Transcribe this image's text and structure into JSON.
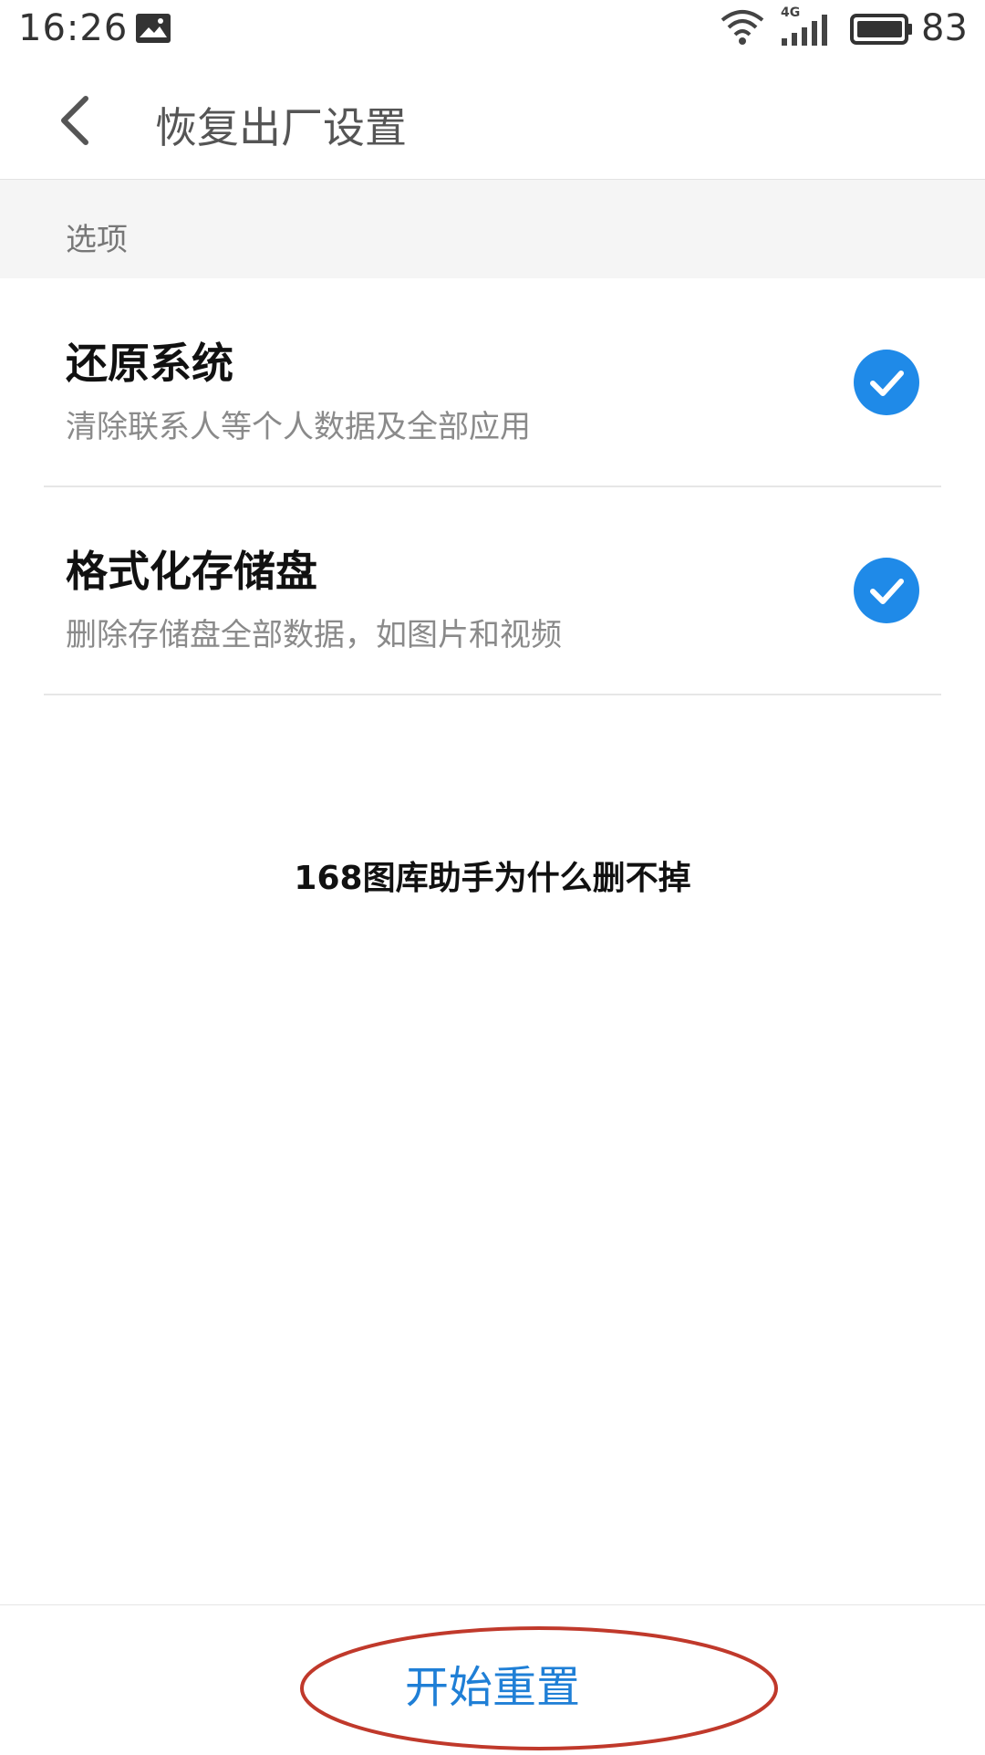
{
  "status_bar": {
    "time": "16:26",
    "network": "4G",
    "battery_level": "83"
  },
  "title_bar": {
    "title": "恢复出厂设置"
  },
  "section": {
    "label": "选项"
  },
  "options": [
    {
      "title": "还原系统",
      "description": "清除联系人等个人数据及全部应用",
      "checked": true
    },
    {
      "title": "格式化存储盘",
      "description": "删除存储盘全部数据，如图片和视频",
      "checked": true
    }
  ],
  "overlay_caption": "168图库助手为什么删不掉",
  "bottom": {
    "reset_label": "开始重置"
  },
  "colors": {
    "accent": "#1f8ae8",
    "highlight": "#c0392b"
  }
}
